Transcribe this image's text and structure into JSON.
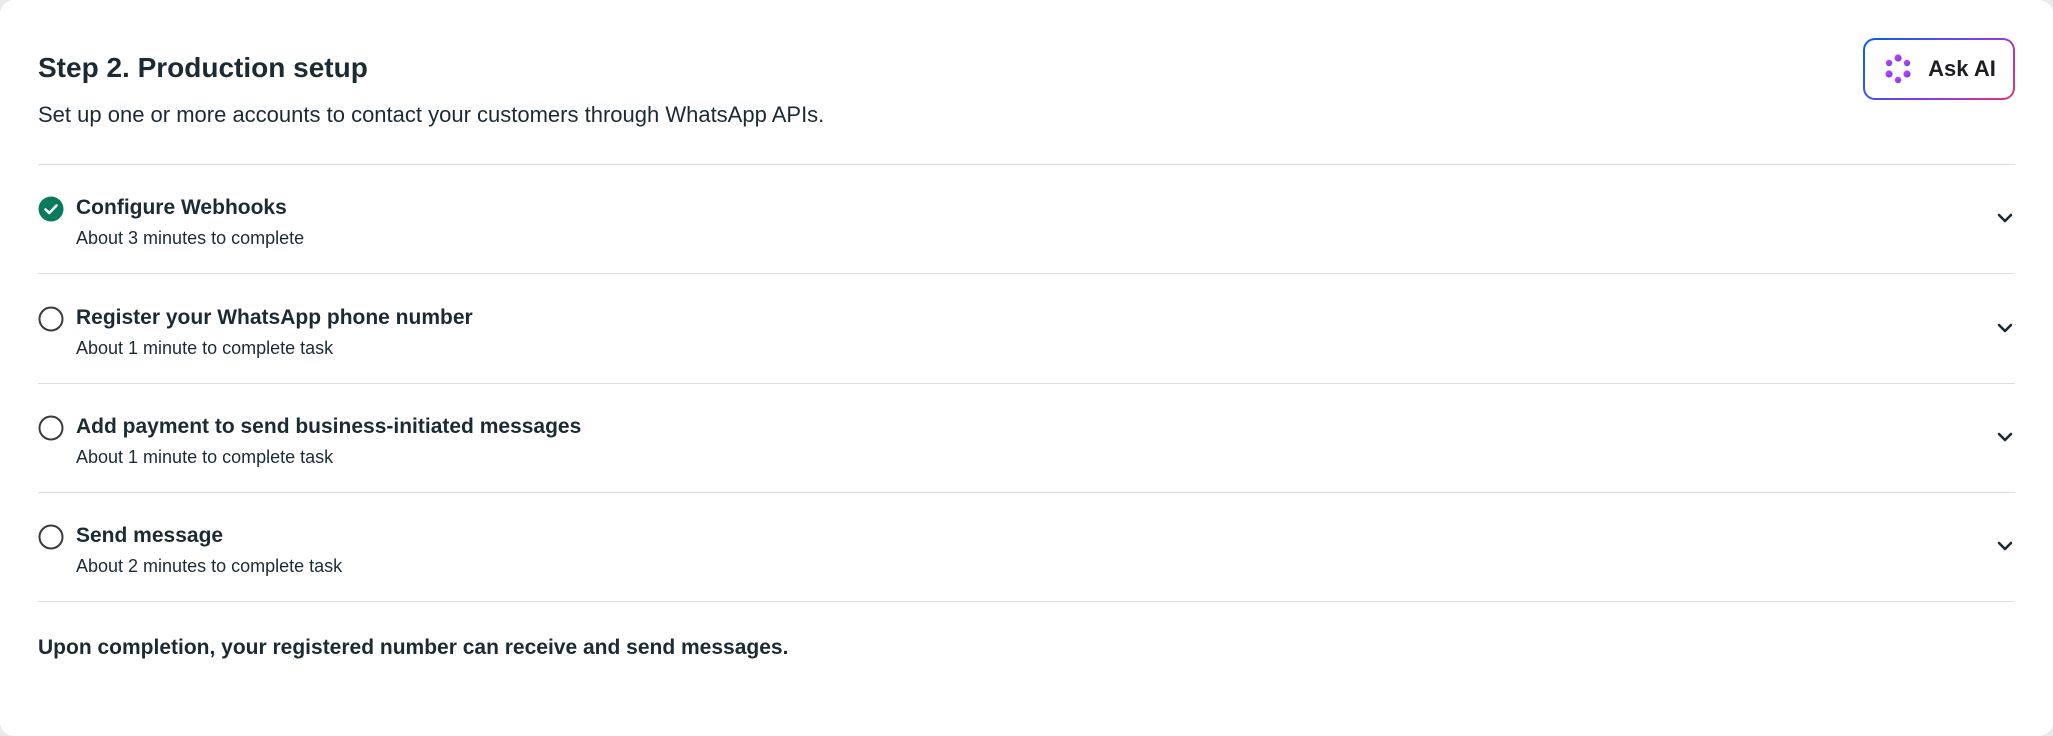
{
  "header": {
    "title": "Step 2. Production setup",
    "subtitle": "Set up one or more accounts to contact your customers through WhatsApp APIs.",
    "ask_ai_label": "Ask AI"
  },
  "steps": [
    {
      "title": "Configure Webhooks",
      "subtitle": "About 3 minutes to complete",
      "completed": true
    },
    {
      "title": "Register your WhatsApp phone number",
      "subtitle": "About 1 minute to complete task",
      "completed": false
    },
    {
      "title": "Add payment to send business-initiated messages",
      "subtitle": "About 1 minute to complete task",
      "completed": false
    },
    {
      "title": "Send message",
      "subtitle": "About 2 minutes to complete task",
      "completed": false
    }
  ],
  "footer": {
    "note": "Upon completion, your registered number can receive and send messages."
  },
  "colors": {
    "complete": "#0a7a5c",
    "incomplete_ring": "#65676b",
    "divider": "#dadde1",
    "ask_ai_gradient": [
      "#0064e0",
      "#7b3ff2",
      "#e8336d"
    ]
  },
  "icons": {
    "complete": "check-circle-icon",
    "incomplete": "empty-circle-icon",
    "expand": "chevron-down-icon",
    "ai": "ai-sparkle-icon"
  }
}
